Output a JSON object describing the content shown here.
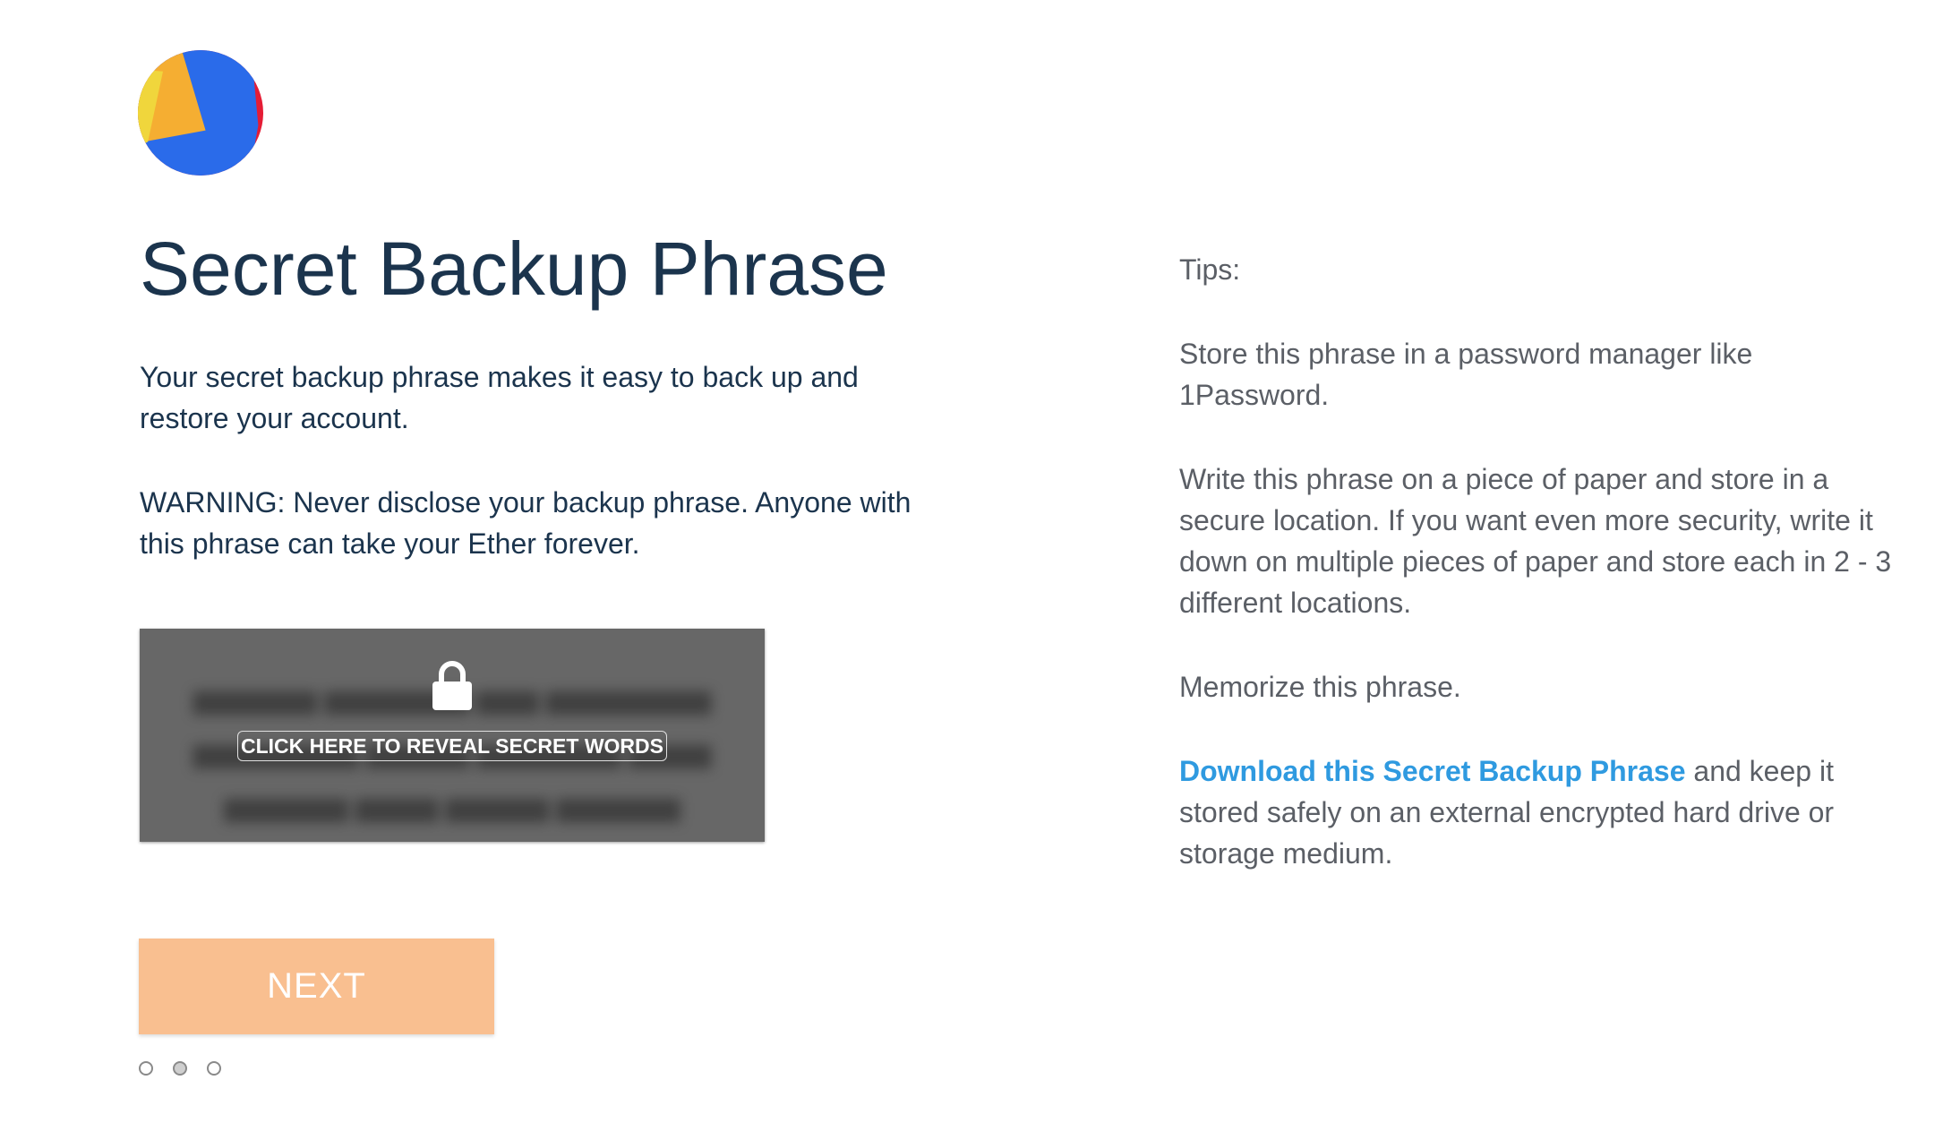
{
  "logo": {
    "icon": "metamask-fox-logo-icon"
  },
  "title": "Secret Backup Phrase",
  "intro": "Your secret backup phrase makes it easy to back up and restore your account.",
  "warning": "WARNING: Never disclose your backup phrase. Anyone with this phrase can take your Ether forever.",
  "reveal": {
    "label": "CLICK HERE TO REVEAL SECRET WORDS",
    "icon": "lock-icon"
  },
  "next_button": "NEXT",
  "step_dots": {
    "count": 3,
    "active_index": 1
  },
  "tips": {
    "heading": "Tips:",
    "items": [
      "Store this phrase in a password manager like 1Password.",
      "Write this phrase on a piece of paper and store in a secure location. If you want even more security, write it down on multiple pieces of paper and store each in 2 - 3 different locations.",
      "Memorize this phrase."
    ],
    "download_link": "Download this Secret Backup Phrase",
    "download_rest": " and keep it stored safely on an external encrypted hard drive or storage medium."
  },
  "colors": {
    "title": "#1b344d",
    "tips_text": "#5b5f66",
    "link": "#2f9ae0",
    "next_button_bg": "#f9bf90",
    "reveal_bg": "#676767"
  }
}
